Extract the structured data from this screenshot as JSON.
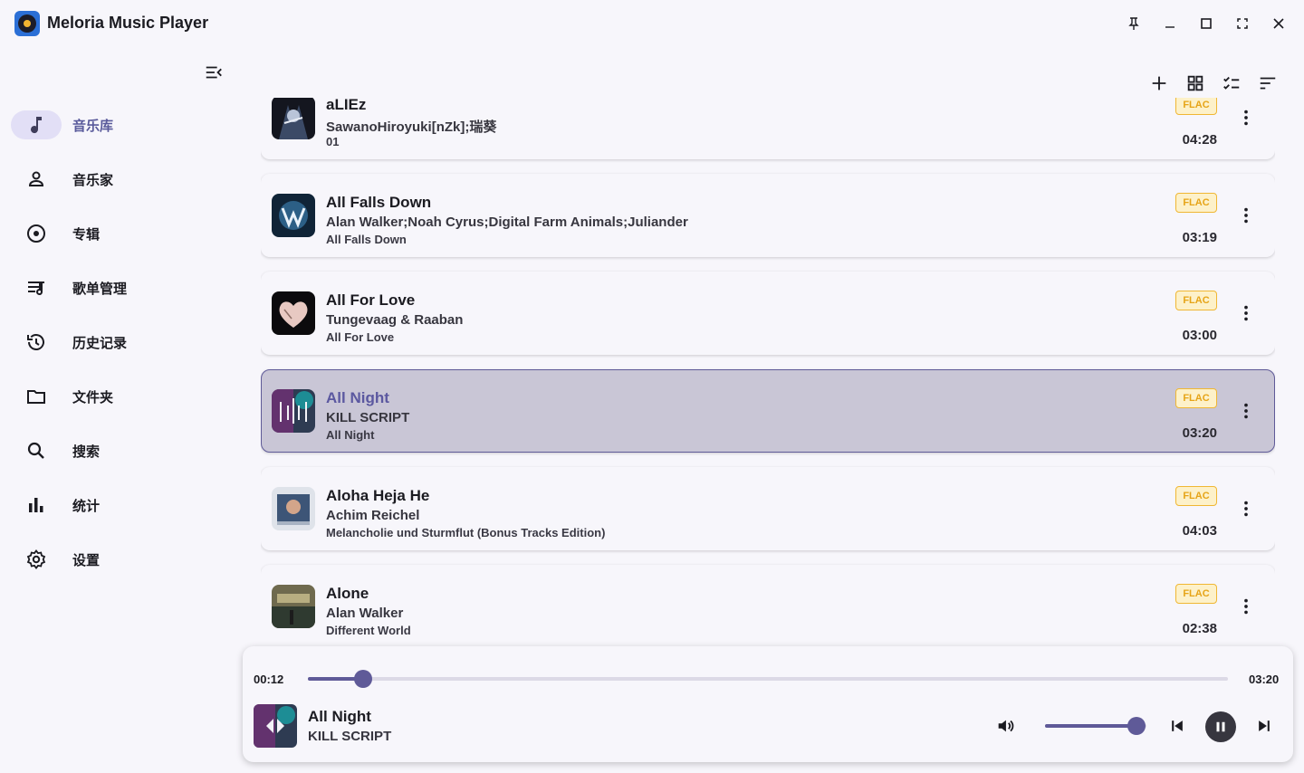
{
  "app": {
    "title": "Meloria Music Player"
  },
  "window_controls": [
    "pin-icon",
    "minimize-icon",
    "maximize-icon",
    "fullscreen-icon",
    "close-icon"
  ],
  "sidebar": {
    "items": [
      {
        "label": "音乐库",
        "icon": "music-note-icon",
        "active": true
      },
      {
        "label": "音乐家",
        "icon": "person-icon",
        "active": false
      },
      {
        "label": "专辑",
        "icon": "album-icon",
        "active": false
      },
      {
        "label": "歌单管理",
        "icon": "playlist-icon",
        "active": false
      },
      {
        "label": "历史记录",
        "icon": "history-icon",
        "active": false
      },
      {
        "label": "文件夹",
        "icon": "folder-icon",
        "active": false
      },
      {
        "label": "搜索",
        "icon": "search-icon",
        "active": false
      },
      {
        "label": "统计",
        "icon": "bar-chart-icon",
        "active": false
      },
      {
        "label": "设置",
        "icon": "settings-icon",
        "active": false
      }
    ]
  },
  "toolbar": [
    "add-icon",
    "grid-view-icon",
    "multi-select-icon",
    "sort-icon"
  ],
  "songs": [
    {
      "title": "aLIEz",
      "artist": "SawanoHiroyuki[nZk];瑞葵",
      "album": "01",
      "format": "FLAC",
      "duration": "04:28",
      "active": false
    },
    {
      "title": "All Falls Down",
      "artist": "Alan Walker;Noah Cyrus;Digital Farm Animals;Juliander",
      "album": "All Falls Down",
      "format": "FLAC",
      "duration": "03:19",
      "active": false
    },
    {
      "title": "All For Love",
      "artist": "Tungevaag & Raaban",
      "album": "All For Love",
      "format": "FLAC",
      "duration": "03:00",
      "active": false
    },
    {
      "title": "All Night",
      "artist": "KILL SCRIPT",
      "album": "All Night",
      "format": "FLAC",
      "duration": "03:20",
      "active": true
    },
    {
      "title": "Aloha Heja He",
      "artist": "Achim Reichel",
      "album": "Melancholie und Sturmflut (Bonus Tracks Edition)",
      "format": "FLAC",
      "duration": "04:03",
      "active": false
    },
    {
      "title": "Alone",
      "artist": "Alan Walker",
      "album": "Different World",
      "format": "FLAC",
      "duration": "02:38",
      "active": false
    }
  ],
  "player": {
    "current_time": "00:12",
    "total_time": "03:20",
    "progress": 0.06,
    "volume": 0.9,
    "title": "All Night",
    "artist": "KILL SCRIPT",
    "colors": {
      "accent": "#5f5a98",
      "badge": "#f0b733",
      "active_row": "#c9c6d6"
    }
  }
}
